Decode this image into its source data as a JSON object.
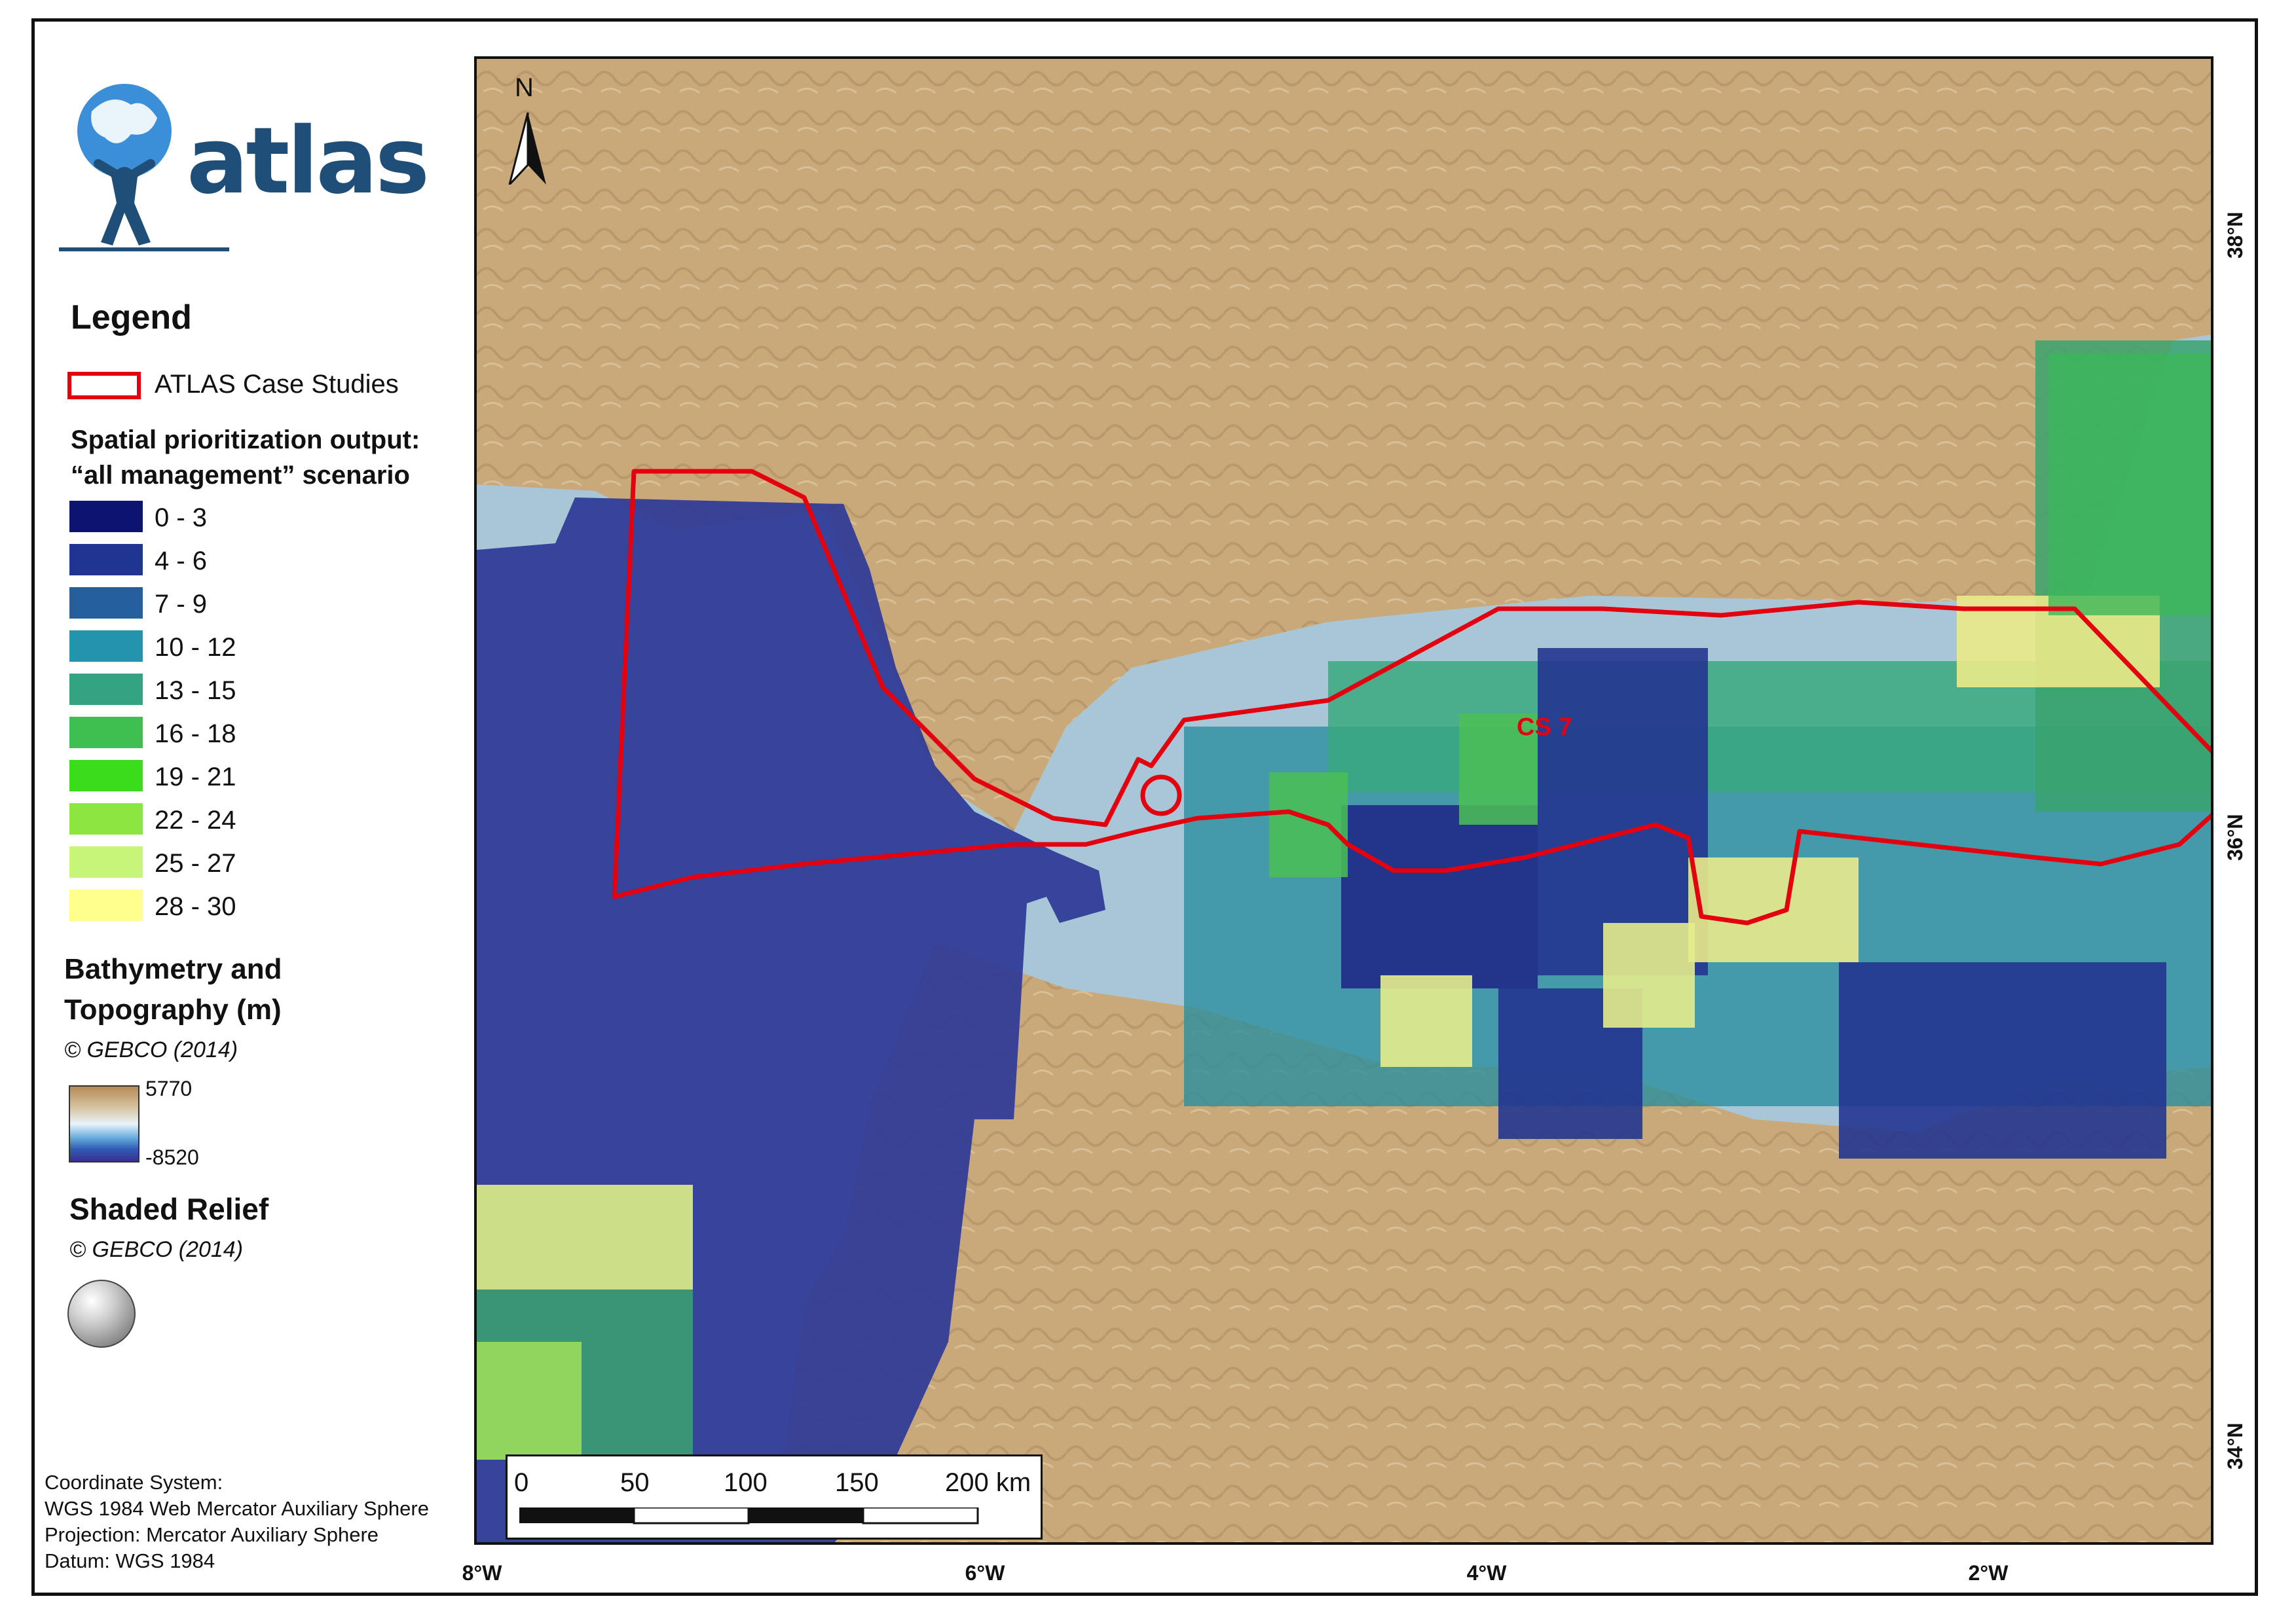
{
  "logo": {
    "text": "atlas"
  },
  "legend": {
    "title": "Legend",
    "case_studies_label": "ATLAS Case Studies",
    "case_studies_color": "#e3000f",
    "spatial_title_line1": "Spatial prioritization output:",
    "spatial_title_line2": "“all management” scenario",
    "classes": [
      {
        "label": "0 - 3",
        "color": "#0d1370"
      },
      {
        "label": "4 - 6",
        "color": "#1f3590"
      },
      {
        "label": "7 - 9",
        "color": "#25609c"
      },
      {
        "label": "10 - 12",
        "color": "#2295ad"
      },
      {
        "label": "13 - 15",
        "color": "#34a382"
      },
      {
        "label": "16 - 18",
        "color": "#3fbf50"
      },
      {
        "label": "19 - 21",
        "color": "#3bdc1c"
      },
      {
        "label": "22 - 24",
        "color": "#8de640"
      },
      {
        "label": "25 - 27",
        "color": "#c7f57a"
      },
      {
        "label": "28 - 30",
        "color": "#ffff8e"
      }
    ],
    "bathy_line1": "Bathymetry and",
    "bathy_line2": "Topography (m)",
    "bathy_credit": "© GEBCO (2014)",
    "ramp_max": "5770",
    "ramp_min": "-8520",
    "shaded_title": "Shaded Relief",
    "shaded_credit": "© GEBCO (2014)"
  },
  "coordinate_info": {
    "line1": "Coordinate System:",
    "line2": "WGS 1984 Web Mercator Auxiliary Sphere",
    "line3": "Projection: Mercator Auxiliary Sphere",
    "line4": "Datum: WGS 1984"
  },
  "map": {
    "north_label": "N",
    "case_label": "CS 7",
    "scale": {
      "labels": [
        "0",
        "50",
        "100",
        "150",
        "200 km"
      ]
    },
    "x_ticks": [
      "8°W",
      "6°W",
      "4°W",
      "2°W"
    ],
    "y_ticks": [
      "38°N",
      "36°N",
      "34°N"
    ]
  }
}
